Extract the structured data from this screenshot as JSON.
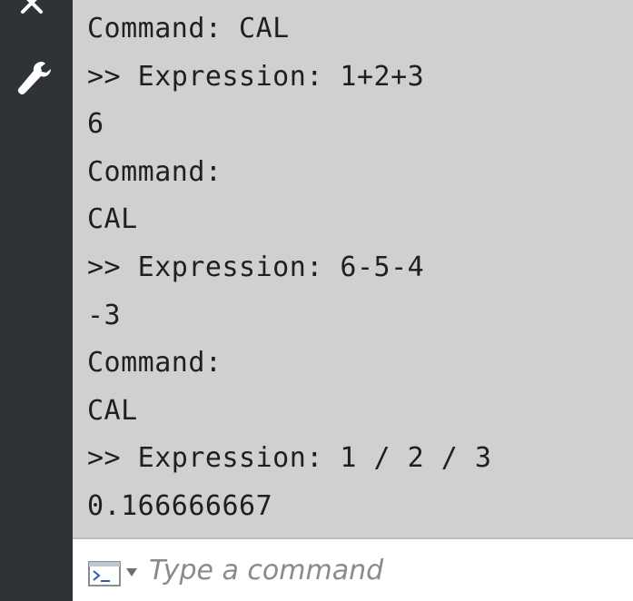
{
  "sidebar": {
    "icons": [
      "close-icon",
      "wrench-icon"
    ]
  },
  "history": {
    "lines": [
      "Command: CAL",
      ">> Expression: 1+2+3",
      "6",
      "Command:",
      "CAL",
      ">> Expression: 6-5-4",
      "-3",
      "Command:",
      "CAL",
      ">> Expression: 1 / 2 / 3",
      "0.166666667"
    ]
  },
  "command_bar": {
    "placeholder": "Type a command",
    "value": ""
  },
  "colors": {
    "strip": "#2f3338",
    "history_bg": "#d0d0d0",
    "text": "#1f1f1f",
    "placeholder": "#8a8a8a"
  }
}
